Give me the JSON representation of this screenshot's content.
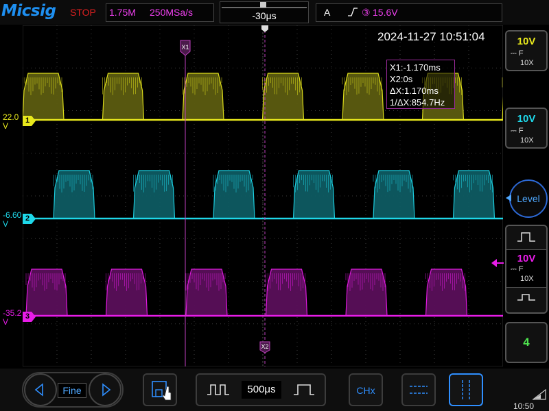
{
  "header": {
    "logo": "Micsig",
    "run_state": "STOP",
    "memory_depth": "1.75M",
    "sample_rate": "250MSa/s",
    "time_offset": "-30μs",
    "trigger": {
      "mode": "A",
      "edge_symbol": "⎍",
      "source": "③",
      "level": "15.6V"
    }
  },
  "screen": {
    "timestamp": "2024-11-27 10:51:04",
    "cursor_readout": {
      "x1": "X1:-1.170ms",
      "x2": "X2:0s",
      "dx": "ΔX:1.170ms",
      "inv_dx": "1/ΔX:854.7Hz"
    },
    "cursor_labels": {
      "x1": "X1",
      "x2": "X2"
    }
  },
  "channels": [
    {
      "id": "1",
      "level_label": "22.0\nV",
      "color": "#e8e81c",
      "volts_div": "10V",
      "coupling": "⎓ F",
      "probe": "10X"
    },
    {
      "id": "2",
      "level_label": "-6.60\nV",
      "color": "#1ed8ea",
      "volts_div": "10V",
      "coupling": "⎓ F",
      "probe": "10X"
    },
    {
      "id": "3",
      "level_label": "-35.2\nV",
      "color": "#e81ce8",
      "volts_div": "10V",
      "coupling": "⎓ F",
      "probe": "10X"
    }
  ],
  "right_panel": {
    "level_button": "Level",
    "channel4_button": "4",
    "clock": "10:50"
  },
  "bottom": {
    "fine_label": "Fine",
    "time_div": "500μs",
    "chx_label": "CHx"
  },
  "colors": {
    "ch1": "#e8e81c",
    "ch2": "#1ed8ea",
    "ch3": "#e81ce8",
    "accent": "#2f8fff",
    "stop": "#e02020"
  },
  "icons": [
    "arrow-left-icon",
    "arrow-right-icon",
    "save-touch-icon",
    "pulse-wide-icon",
    "pulse-narrow-icon",
    "horizontal-cursor-icon",
    "vertical-cursor-icon",
    "square-wave-icon",
    "trigger-marker-icon",
    "battery-icon"
  ]
}
